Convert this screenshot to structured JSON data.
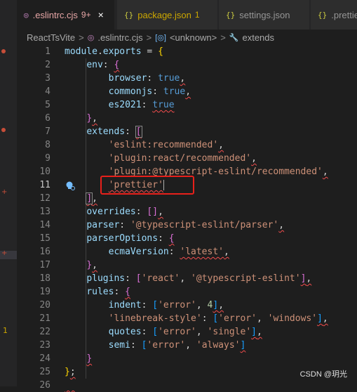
{
  "tabs": [
    {
      "icon": "eslint-dot-icon",
      "label": ".eslintrc.cjs",
      "badge": "9+",
      "active": true
    },
    {
      "icon": "json-braces-icon",
      "label": "package.json",
      "badge": "1",
      "active": false
    },
    {
      "icon": "json-braces-icon",
      "label": "settings.json",
      "badge": "",
      "active": false
    },
    {
      "icon": "json-braces-icon",
      "label": ".prettie",
      "badge": "",
      "active": false
    }
  ],
  "close_glyph": "×",
  "breadcrumb": {
    "items": [
      "ReactTsVite",
      ".eslintrc.cjs",
      "<unknown>",
      "extends"
    ],
    "separator": ">"
  },
  "editor": {
    "current_line": 11,
    "line_numbers": [
      "1",
      "2",
      "3",
      "4",
      "5",
      "6",
      "7",
      "8",
      "9",
      "10",
      "11",
      "12",
      "13",
      "14",
      "15",
      "16",
      "17",
      "18",
      "19",
      "20",
      "21",
      "22",
      "23",
      "24",
      "25",
      "26"
    ],
    "code": {
      "l1": {
        "module": "module",
        "dot": ".",
        "exports": "exports",
        " eq": " = ",
        "brace": "{"
      },
      "l2": {
        "key": "env",
        "colon": ": ",
        "brace": "{"
      },
      "l3": {
        "key": "browser",
        "colon": ": ",
        "val": "true",
        "comma": ","
      },
      "l4": {
        "key": "commonjs",
        "colon": ": ",
        "val": "true",
        "comma": ","
      },
      "l5": {
        "key": "es2021",
        "colon": ": ",
        "val": "true"
      },
      "l6": {
        "brace": "}",
        "comma": ","
      },
      "l7": {
        "key": "extends",
        "colon": ": ",
        "bracket": "["
      },
      "l8": {
        "str": "'eslint:recommended'",
        "comma": ","
      },
      "l9": {
        "str": "'plugin:react/recommended'",
        "comma": ","
      },
      "l10": {
        "str": "'plugin:@typescript-eslint/recommended'",
        "comma": ","
      },
      "l11": {
        "str": "'prettier'"
      },
      "l12": {
        "bracket": "]",
        "comma": ","
      },
      "l13": {
        "key": "overrides",
        "colon": ": ",
        "open": "[",
        "close": "]",
        "comma": ","
      },
      "l14": {
        "key": "parser",
        "colon": ": ",
        "str": "'@typescript-eslint/parser'",
        "comma": ","
      },
      "l15": {
        "key": "parserOptions",
        "colon": ": ",
        "brace": "{"
      },
      "l16": {
        "key": "ecmaVersion",
        "colon": ": ",
        "str": "'latest'",
        "comma": ","
      },
      "l17": {
        "brace": "}",
        "comma": ","
      },
      "l18": {
        "key": "plugins",
        "colon": ": ",
        "open": "[",
        "s1": "'react'",
        "c1": ", ",
        "s2": "'@typescript-eslint'",
        "close": "]",
        "comma": ","
      },
      "l19": {
        "key": "rules",
        "colon": ": ",
        "brace": "{"
      },
      "l20": {
        "key": "indent",
        "colon": ": ",
        "open": "[",
        "s1": "'error'",
        "c1": ", ",
        "num": "4",
        "close": "]",
        "comma": ","
      },
      "l21": {
        "key": "'linebreak-style'",
        "colon": ": ",
        "open": "[",
        "s1": "'error'",
        "c1": ", ",
        "s2": "'windows'",
        "close": "]",
        "comma": ","
      },
      "l22": {
        "key": "quotes",
        "colon": ": ",
        "open": "[",
        "s1": "'error'",
        "c1": ", ",
        "s2": "'single'",
        "close": "]",
        "comma": ","
      },
      "l23": {
        "key": "semi",
        "colon": ": ",
        "open": "[",
        "s1": "'error'",
        "c1": ", ",
        "s2": "'always'",
        "close": "]"
      },
      "l24": {
        "brace": "}"
      },
      "l25": {
        "brace": "}",
        "semi": ";"
      }
    }
  },
  "activity_markers": {
    "badge_number": "1"
  },
  "watermark": "CSDN @玥光",
  "colors": {
    "error_squiggle": "#f14c4c",
    "highlight_box": "#e8201a",
    "key": "#9cdcfe",
    "string": "#ce9178",
    "keyword": "#569cd6",
    "number": "#b5cea8"
  }
}
